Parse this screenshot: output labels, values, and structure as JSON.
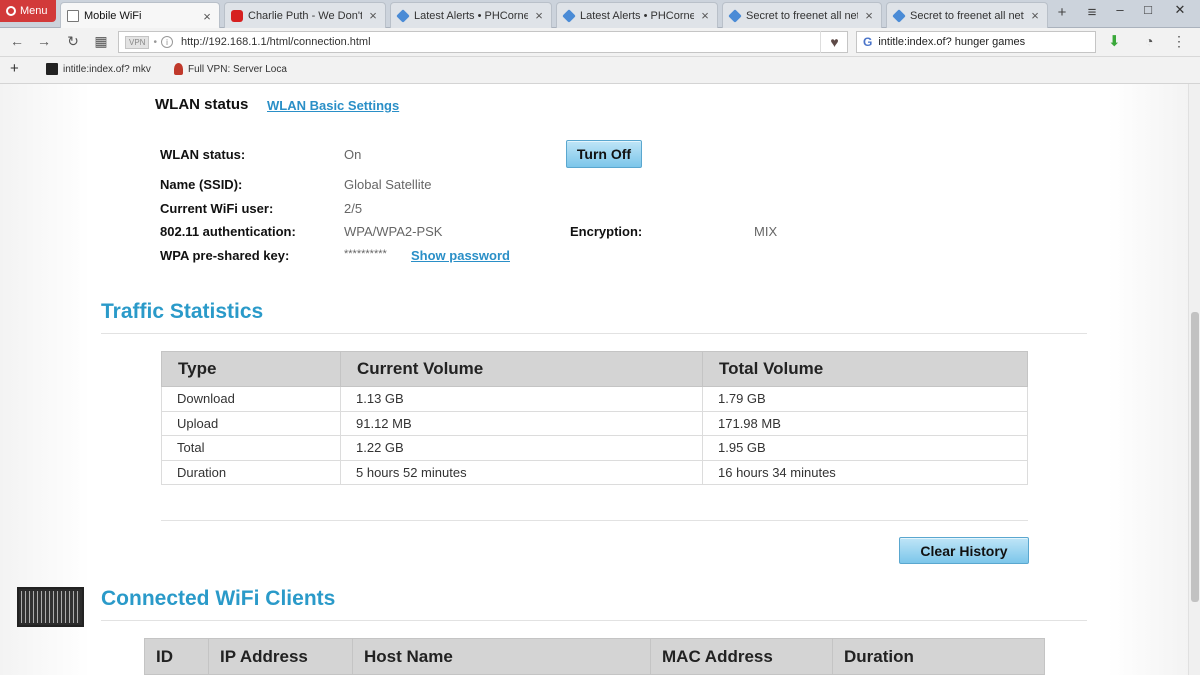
{
  "browser": {
    "menu_label": "Menu",
    "tabs": [
      {
        "title": "Mobile WiFi",
        "icon": "page-icon",
        "active": true
      },
      {
        "title": "Charlie Puth - We Don't T",
        "icon": "youtube-icon"
      },
      {
        "title": "Latest Alerts • PHCorner",
        "icon": "phcorner-icon"
      },
      {
        "title": "Latest Alerts • PHCorner",
        "icon": "phcorner-icon"
      },
      {
        "title": "Secret to freenet all netw",
        "icon": "phcorner-icon"
      },
      {
        "title": "Secret to freenet all netw",
        "icon": "phcorner-icon"
      }
    ],
    "vpn_badge": "VPN",
    "url": "http://192.168.1.1/html/connection.html",
    "search_text": "intitle:index.of? hunger games",
    "bookmarks": [
      {
        "label": "intitle:index.of? mkv"
      },
      {
        "label": "Full VPN: Server Loca"
      }
    ]
  },
  "wlan": {
    "heading": "WLAN status",
    "settings_link": "WLAN Basic Settings",
    "status_label": "WLAN status:",
    "status_value": "On",
    "turn_off_label": "Turn Off",
    "ssid_label": "Name (SSID):",
    "ssid_value": "Global Satellite",
    "users_label": "Current WiFi user:",
    "users_value": "2/5",
    "auth_label": "802.11 authentication:",
    "auth_value": "WPA/WPA2-PSK",
    "encryption_label": "Encryption:",
    "encryption_value": "MIX",
    "psk_label": "WPA pre-shared key:",
    "psk_value": "**********",
    "show_password": "Show password"
  },
  "traffic": {
    "title": "Traffic Statistics",
    "headers": [
      "Type",
      "Current Volume",
      "Total Volume"
    ],
    "rows": [
      [
        "Download",
        "1.13 GB",
        "1.79 GB"
      ],
      [
        "Upload",
        "91.12 MB",
        "171.98 MB"
      ],
      [
        "Total",
        "1.22 GB",
        "1.95 GB"
      ],
      [
        "Duration",
        "5 hours 52 minutes",
        "16 hours 34 minutes"
      ]
    ],
    "clear_history": "Clear History"
  },
  "clients": {
    "title": "Connected WiFi Clients",
    "headers": [
      "ID",
      "IP Address",
      "Host Name",
      "MAC Address",
      "Duration"
    ]
  },
  "colors": {
    "accent": "#2a9ac9",
    "link": "#2a8fc7",
    "button": "#7cc6ea",
    "header_bg": "#d4d4d4"
  }
}
